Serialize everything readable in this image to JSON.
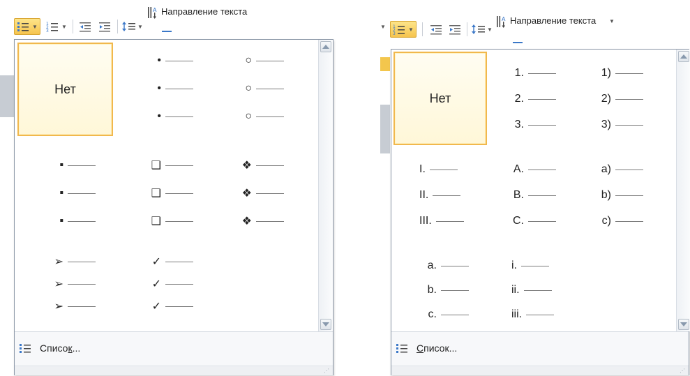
{
  "left": {
    "ribbon": {
      "text_direction_label": "Направление текста"
    },
    "gallery": {
      "none_label": "Нет",
      "columns": [
        {
          "marker": "•"
        },
        {
          "marker": "○"
        },
        {
          "marker": "▪"
        },
        {
          "marker": "❑"
        },
        {
          "marker": "❖"
        },
        {
          "marker": "➢"
        },
        {
          "marker": "✓"
        }
      ]
    },
    "footer": {
      "label_prefix": "Списо",
      "label_accel": "к",
      "label_suffix": "..."
    }
  },
  "right": {
    "ribbon": {
      "text_direction_label": "Направление текста"
    },
    "gallery": {
      "none_label": "Нет",
      "decimal_dot": [
        "1.",
        "2.",
        "3."
      ],
      "decimal_paren": [
        "1)",
        "2)",
        "3)"
      ],
      "upper_roman": [
        "I.",
        "II.",
        "III."
      ],
      "upper_alpha": [
        "A.",
        "B.",
        "C."
      ],
      "lower_alpha_paren": [
        "a)",
        "b)",
        "c)"
      ],
      "lower_alpha": [
        "a.",
        "b.",
        "c."
      ],
      "lower_roman": [
        "i.",
        "ii.",
        "iii."
      ]
    },
    "footer": {
      "label_accel": "С",
      "label_rest": "писок..."
    }
  },
  "colors": {
    "active_button": "#f6c44e",
    "selected_border": "#f1b84d",
    "dropdown_border": "#8a96a6",
    "icon_blue": "#3b78c8"
  }
}
